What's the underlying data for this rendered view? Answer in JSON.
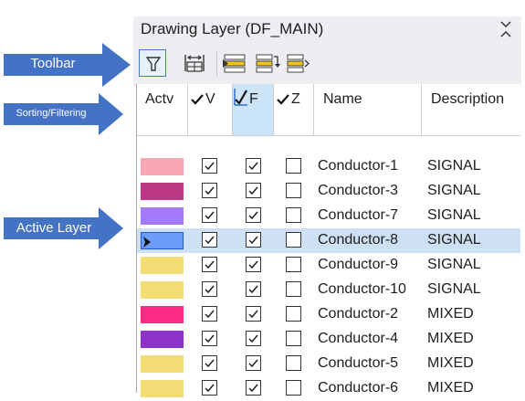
{
  "panel": {
    "title": "Drawing Layer (DF_MAIN)",
    "close_icon": "pin-close-icon"
  },
  "toolbar": {
    "buttons": [
      {
        "icon": "filter-icon",
        "active": true
      },
      {
        "icon": "column-width-icon",
        "active": false
      },
      {
        "icon": "layer-stack-icon",
        "active": false
      },
      {
        "icon": "layer-swap-icon",
        "active": false
      },
      {
        "icon": "layer-forward-icon",
        "active": false
      }
    ]
  },
  "columns": {
    "actv": "Actv",
    "v": "V",
    "f": "F",
    "z": "Z",
    "name": "Name",
    "description": "Description",
    "v_checked": true,
    "f_checked": true,
    "z_checked": true,
    "f_selected": true
  },
  "rows": [
    {
      "color": "#f9a7b5",
      "v": true,
      "f": true,
      "z": false,
      "name": "Conductor-1",
      "description": "SIGNAL",
      "active": false
    },
    {
      "color": "#bc3a85",
      "v": true,
      "f": true,
      "z": false,
      "name": "Conductor-3",
      "description": "SIGNAL",
      "active": false
    },
    {
      "color": "#a479fb",
      "v": true,
      "f": true,
      "z": false,
      "name": "Conductor-7",
      "description": "SIGNAL",
      "active": false
    },
    {
      "color": "#6b9df8",
      "v": true,
      "f": true,
      "z": false,
      "name": "Conductor-8",
      "description": "SIGNAL",
      "active": true
    },
    {
      "color": "#f2dd75",
      "v": true,
      "f": true,
      "z": false,
      "name": "Conductor-9",
      "description": "SIGNAL",
      "active": false
    },
    {
      "color": "#f2dd75",
      "v": true,
      "f": true,
      "z": false,
      "name": "Conductor-10",
      "description": "SIGNAL",
      "active": false
    },
    {
      "color": "#fb2a84",
      "v": true,
      "f": true,
      "z": false,
      "name": "Conductor-2",
      "description": "MIXED",
      "active": false
    },
    {
      "color": "#8e33c8",
      "v": true,
      "f": true,
      "z": false,
      "name": "Conductor-4",
      "description": "MIXED",
      "active": false
    },
    {
      "color": "#f2dd75",
      "v": true,
      "f": true,
      "z": false,
      "name": "Conductor-5",
      "description": "MIXED",
      "active": false
    },
    {
      "color": "#f2dd75",
      "v": true,
      "f": true,
      "z": false,
      "name": "Conductor-6",
      "description": "MIXED",
      "active": false
    }
  ],
  "callouts": {
    "toolbar": "Toolbar",
    "sorting": "Sorting/Filtering",
    "active_layer": "Active Layer",
    "color": "#4472c4"
  },
  "colors": {
    "accent": "#3d7bd6",
    "active_row": "#cde0f4",
    "selected_header": "#cce4f7"
  }
}
